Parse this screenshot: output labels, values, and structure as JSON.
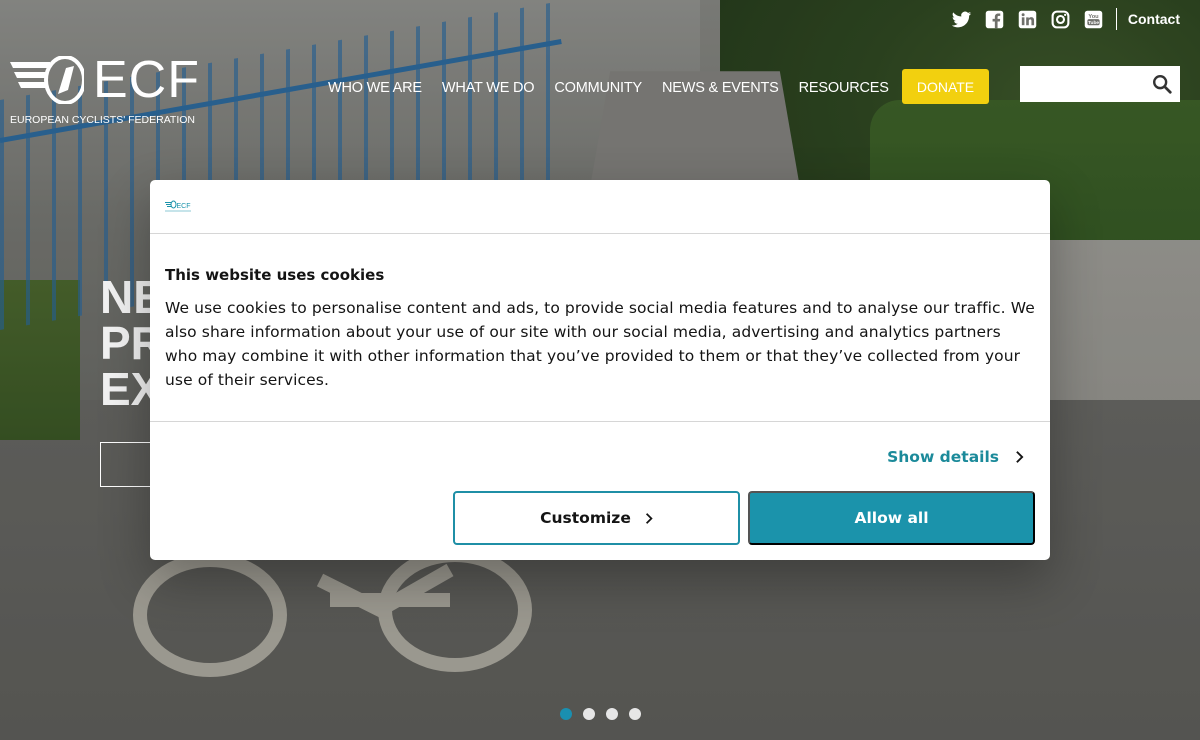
{
  "header": {
    "logo_text": "ECF",
    "logo_subtitle": "EUROPEAN CYCLISTS' FEDERATION",
    "contact_label": "Contact",
    "social_icons": [
      "twitter-icon",
      "facebook-icon",
      "linkedin-icon",
      "instagram-icon",
      "youtube-icon"
    ],
    "nav": [
      "WHO WE ARE",
      "WHAT WE DO",
      "COMMUNITY",
      "NEWS & EVENTS",
      "RESOURCES"
    ],
    "donate_label": "DONATE",
    "search_placeholder": ""
  },
  "hero": {
    "title_partial": "NE\nPR\nEX"
  },
  "cookie_dialog": {
    "logo_text": "ECF",
    "title": "This website uses cookies",
    "body": "We use cookies to personalise content and ads, to provide social media features and to analyse our traffic. We also share information about your use of our site with our social media, advertising and analytics partners who may combine it with other information that you’ve provided to them or that they’ve collected from your use of their services.",
    "show_details_label": "Show details",
    "customize_label": "Customize",
    "allow_all_label": "Allow all"
  },
  "carousel": {
    "slide_count": 4,
    "active_index": 0
  },
  "colors": {
    "accent": "#1b93ab",
    "donate": "#f2d00f",
    "active_dot": "#1a8fb0"
  }
}
